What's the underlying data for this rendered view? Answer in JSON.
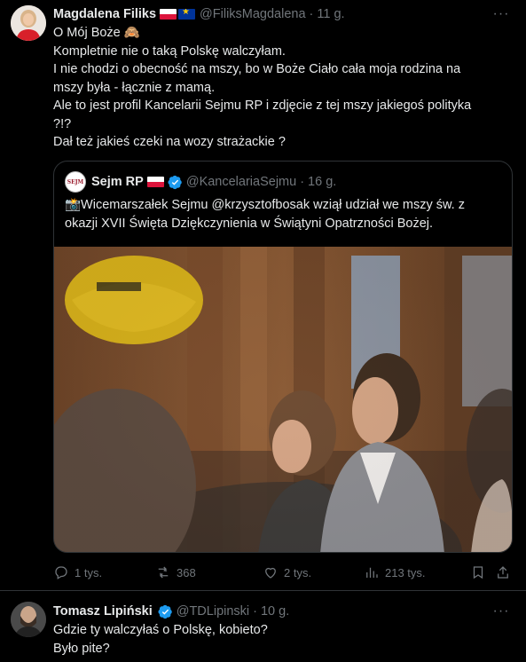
{
  "main_tweet": {
    "author_name": "Magdalena Filiks",
    "author_handle": "@FiliksMagdalena",
    "separator": "·",
    "time": "11 g.",
    "lines": [
      "O Mój Boże 🙈",
      "Kompletnie nie o taką Polskę walczyłam.",
      "I nie chodzi o obecność na mszy, bo w Boże Ciało cała moja rodzina na",
      "mszy była - łącznie z mamą.",
      "Ale to jest profil Kancelarii Sejmu RP i zdjęcie z tej mszy jakiegoś polityka",
      "?!?",
      "Dał też jakieś czeki na wozy strażackie ?"
    ],
    "quote": {
      "avatar_text": "SEJM",
      "author_name": "Sejm RP",
      "author_handle": "@KancelariaSejmu",
      "separator": "·",
      "time": "16 g.",
      "lines": [
        "📸Wicemarszałek Sejmu @krzysztofbosak wziął udział we mszy św. z",
        "okazji XVII Święta Dziękczynienia w Świątyni Opatrzności Bożej."
      ]
    },
    "actions": {
      "replies": "1 tys.",
      "reposts": "368",
      "likes": "2 tys.",
      "views": "213 tys."
    }
  },
  "reply_tweet": {
    "author_name": "Tomasz Lipiński",
    "author_handle": "@TDLipinski",
    "separator": "·",
    "time": "10 g.",
    "lines": [
      "Gdzie ty walczyłaś o Polskę, kobieto?",
      "Było pite?"
    ]
  },
  "colors": {
    "background": "#000000",
    "text": "#e7e9ea",
    "muted": "#71767b",
    "border": "#2f3336",
    "verified": "#1d9bf0"
  },
  "icons": [
    "more-icon",
    "reply-icon",
    "repost-icon",
    "like-icon",
    "views-icon",
    "bookmark-icon",
    "share-icon",
    "verified-icon",
    "flag-pl-icon",
    "flag-eu-icon"
  ]
}
